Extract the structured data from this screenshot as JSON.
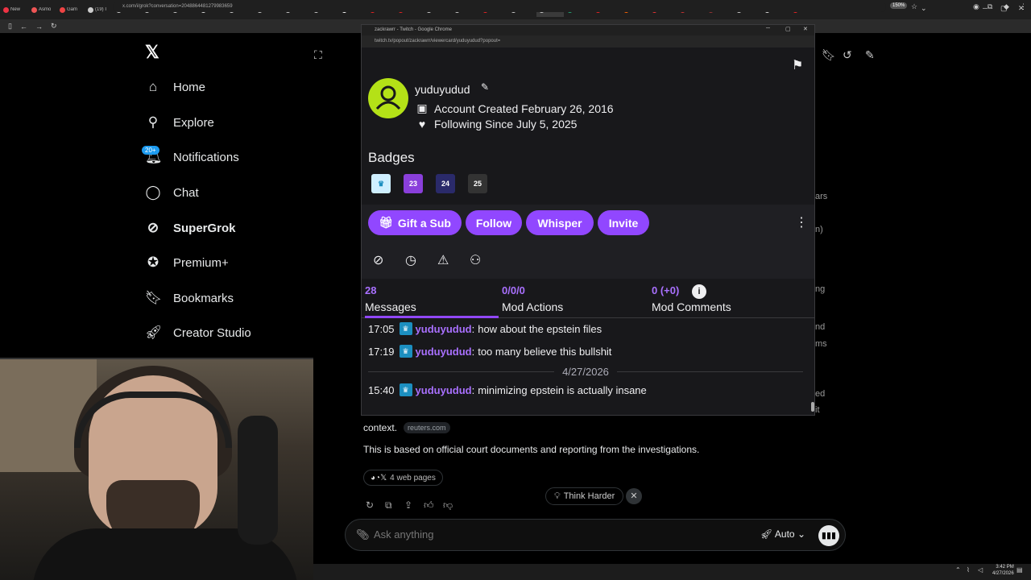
{
  "browser": {
    "tabs": [
      "New",
      "Asmo",
      "Gam",
      "(19) I",
      "(20) I",
      "(20) P",
      "(20) I",
      "HG4A",
      "(21) H",
      "(20) I",
      "(20) I",
      "Home",
      "never",
      "(400)",
      "(400)",
      "Lynas",
      "(21)",
      "(400)",
      "Home",
      "(21) F",
      "Socra",
      "(400)",
      "r/Live",
      "FBI Re",
      "D4ve",
      "D4ve",
      "Zack",
      "tortur",
      "(400)"
    ],
    "url": "x.com/i/grok?conversation=2048864481279983659",
    "zoom": "150%"
  },
  "x_sidebar": {
    "items": [
      {
        "label": "Home",
        "icon": "home-icon"
      },
      {
        "label": "Explore",
        "icon": "search-icon"
      },
      {
        "label": "Notifications",
        "icon": "bell-icon"
      },
      {
        "label": "Chat",
        "icon": "chat-bubble-icon"
      },
      {
        "label": "SuperGrok",
        "icon": "grok-icon"
      },
      {
        "label": "Premium+",
        "icon": "verified-icon"
      },
      {
        "label": "Bookmarks",
        "icon": "bookmark-icon"
      },
      {
        "label": "Creator Studio",
        "icon": "rocket-icon"
      }
    ],
    "notif_badge": "20+"
  },
  "popup": {
    "window_title": "zackrawrr - Twitch - Google Chrome",
    "url": "twitch.tv/popout/zackrawrr/viewercard/yuduyudud?popout=",
    "username": "yuduyudud",
    "account_created": "Account Created February 26, 2016",
    "following_since": "Following Since July 5, 2025",
    "badges_heading": "Badges",
    "badges": [
      {
        "text": "♛",
        "color": "#1c8fc0",
        "bg": "#cfefff"
      },
      {
        "text": "23",
        "color": "#ffffff",
        "bg": "#8a3fdb"
      },
      {
        "text": "24",
        "color": "#ffffff",
        "bg": "#2a2a6a"
      },
      {
        "text": "25",
        "color": "#ffffff",
        "bg": "#333333"
      }
    ],
    "buttons": {
      "gift": "Gift a Sub",
      "follow": "Follow",
      "whisper": "Whisper",
      "invite": "Invite"
    },
    "stats": [
      {
        "value": "28",
        "label": "Messages"
      },
      {
        "value": "0/0/0",
        "label": "Mod Actions"
      },
      {
        "value": "0 (+0)",
        "label": "Mod Comments"
      }
    ],
    "chat": [
      {
        "time": "17:05",
        "user": "yuduyudud",
        "text": "how about the epstein files"
      },
      {
        "time": "17:19",
        "user": "yuduyudud",
        "text": "too many believe this bullshit"
      },
      {
        "time": "15:40",
        "user": "yuduyudud",
        "text": "minimizing epstein is actually insane"
      }
    ],
    "date_divider": "4/27/2026"
  },
  "grok": {
    "context": "context.",
    "source": "reuters.com",
    "body": "This is based on official court documents and reporting from the investigations.",
    "web_pages": "4 web pages",
    "think_harder": "Think Harder",
    "ask_placeholder": "Ask anything",
    "mode": "Auto"
  },
  "behind_fragments": [
    "ars",
    "n)",
    "ng",
    "nd",
    "ms",
    "ed",
    "it"
  ],
  "taskbar": {
    "time": "3:42 PM",
    "date": "4/27/2026"
  }
}
